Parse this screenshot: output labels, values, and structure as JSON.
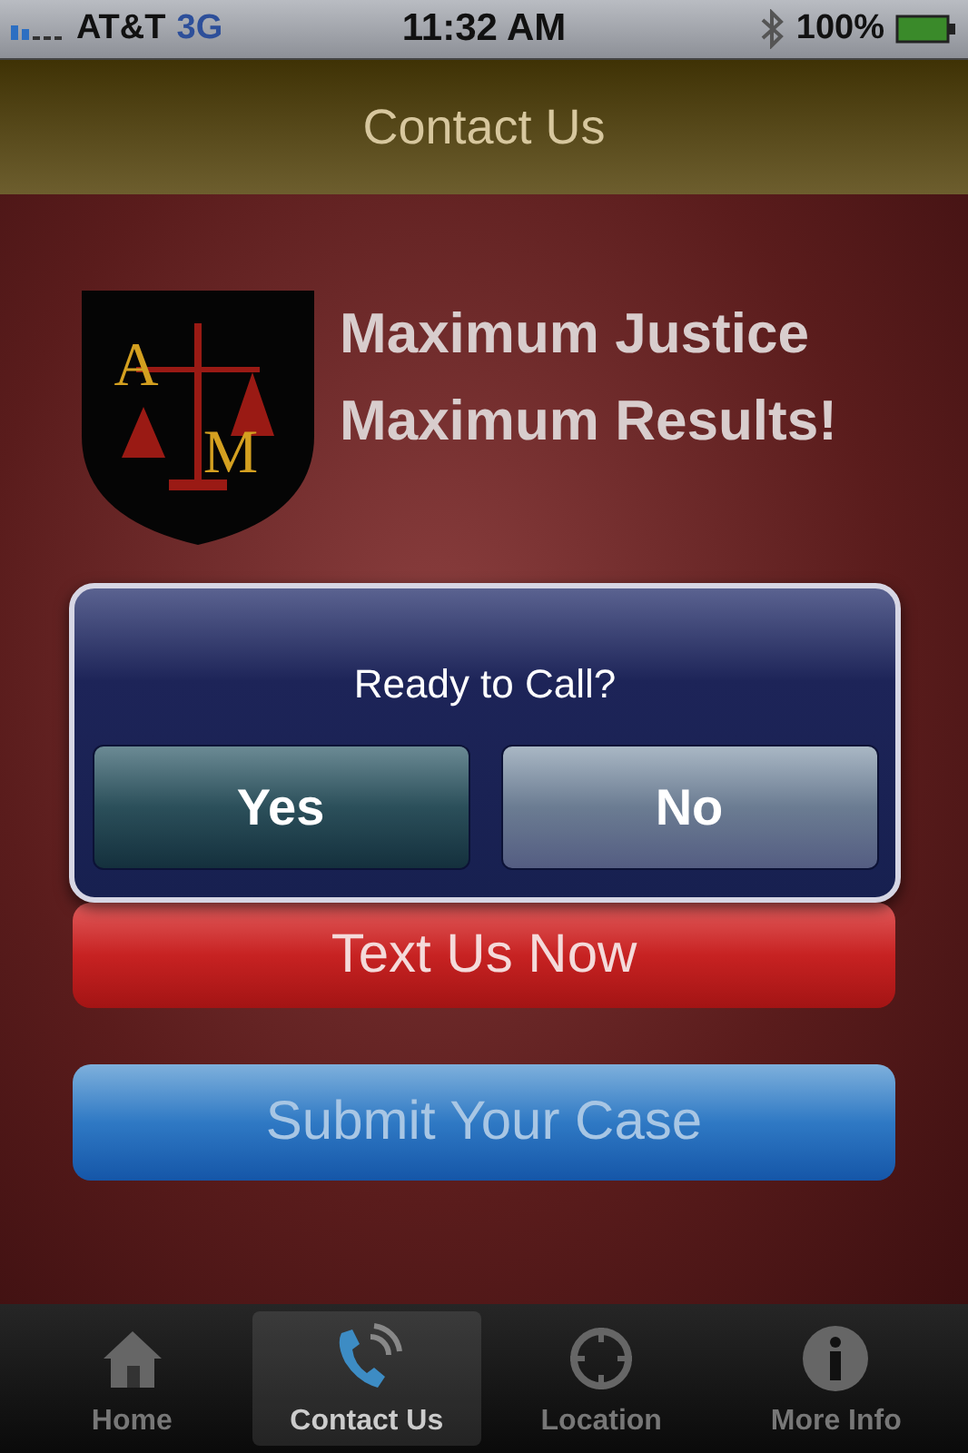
{
  "status_bar": {
    "carrier": "AT&T",
    "network": "3G",
    "time": "11:32 AM",
    "battery": "100%"
  },
  "nav_bar": {
    "title": "Contact Us"
  },
  "logo": {
    "letters": [
      "A",
      "M"
    ]
  },
  "tagline": [
    "Maximum Justice",
    "Maximum Results!"
  ],
  "buttons": [
    {
      "label": "Text Us Now",
      "kind": "red"
    },
    {
      "label": "Submit Your Case",
      "kind": "blue"
    }
  ],
  "alert": {
    "title": "Ready to Call?",
    "buttons": [
      {
        "label": "Yes",
        "kind": "cancel"
      },
      {
        "label": "No",
        "kind": "default"
      }
    ]
  },
  "tab_bar": [
    {
      "label": "Home",
      "kind": "home",
      "selected": false
    },
    {
      "label": "Contact Us",
      "kind": "phone",
      "selected": true
    },
    {
      "label": "Location",
      "kind": "location",
      "selected": false
    },
    {
      "label": "More Info",
      "kind": "info",
      "selected": false
    }
  ]
}
